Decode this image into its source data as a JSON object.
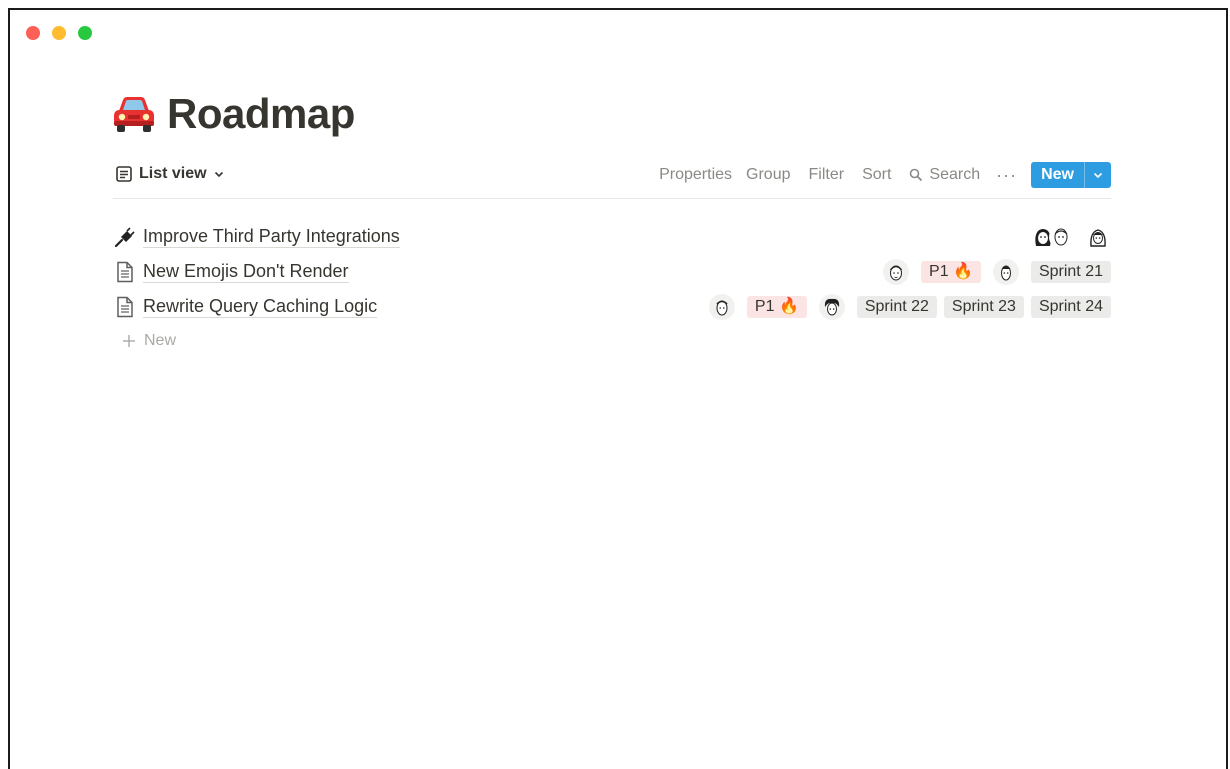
{
  "page": {
    "title": "Roadmap",
    "icon": "car-icon"
  },
  "toolbar": {
    "view_label": "List view",
    "properties": "Properties",
    "group": "Group",
    "filter": "Filter",
    "sort": "Sort",
    "search": "Search",
    "more": "···",
    "new_label": "New"
  },
  "items": [
    {
      "title": "Improve Third Party Integrations",
      "icon": "plug-icon"
    },
    {
      "title": "New Emojis Don't Render",
      "icon": "page-icon",
      "priority": "P1 🔥",
      "sprint": "Sprint 21"
    },
    {
      "title": "Rewrite Query Caching Logic",
      "icon": "page-icon",
      "priority": "P1 🔥",
      "sprints": [
        "Sprint 22",
        "Sprint 23",
        "Sprint 24"
      ]
    }
  ],
  "add_new": "New",
  "colors": {
    "accent": "#2e9ce0",
    "text": "#37352f",
    "muted": "#8a8985",
    "priority_bg": "#fbe4e4",
    "tag_bg": "#ebebea"
  }
}
